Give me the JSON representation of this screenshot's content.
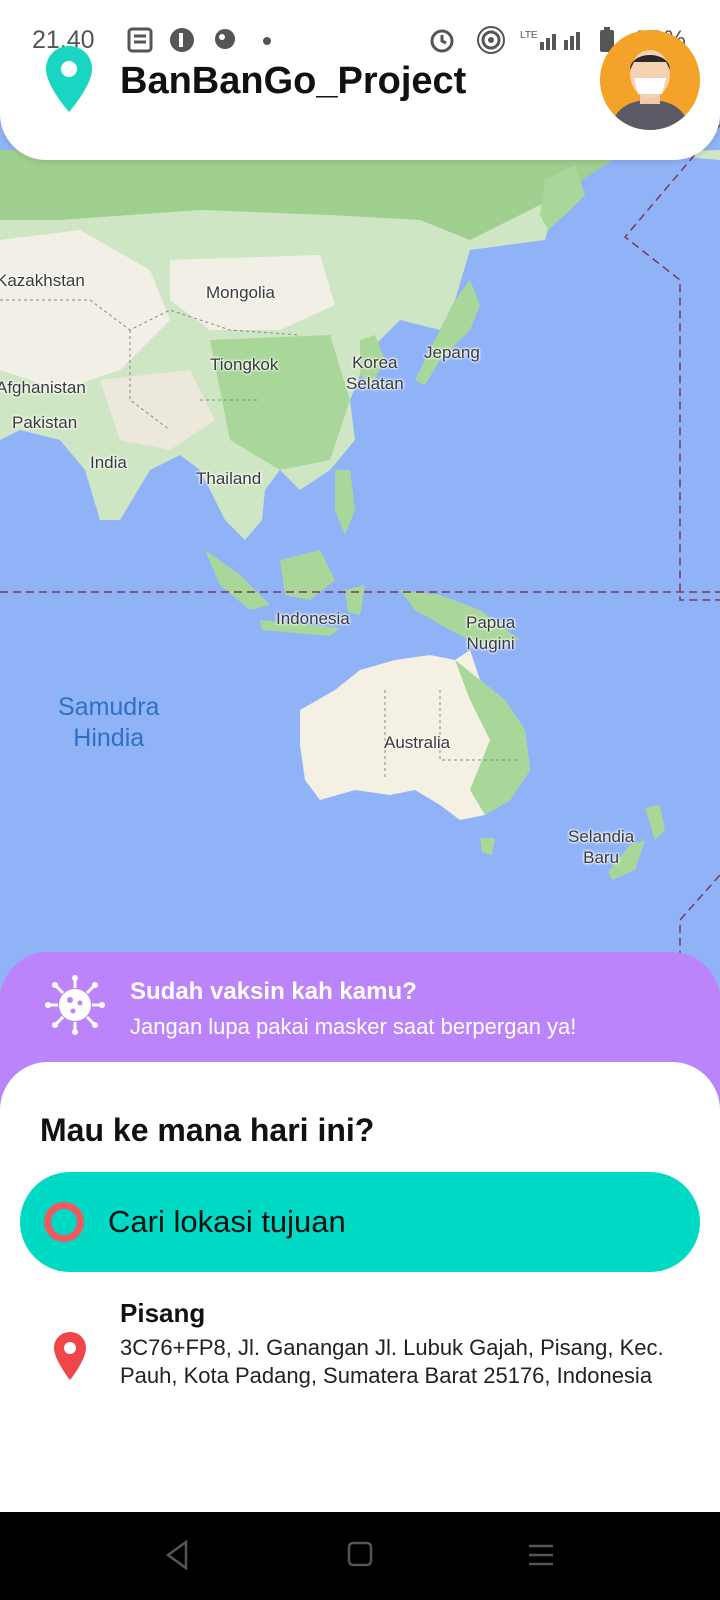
{
  "status_bar": {
    "time": "21.40",
    "network": "LTE",
    "battery": "50%"
  },
  "header": {
    "app_title": "BanBanGo_Project",
    "logo_icon": "location-pin-icon",
    "avatar_icon": "user-avatar-icon"
  },
  "map": {
    "labels": [
      {
        "key": "kazakhstan",
        "text": "Kazakhstan"
      },
      {
        "key": "mongolia",
        "text": "Mongolia"
      },
      {
        "key": "afghanistan",
        "text": "Afghanistan"
      },
      {
        "key": "tiongkok",
        "text": "Tiongkok"
      },
      {
        "key": "korea",
        "text": "Korea\nSelatan"
      },
      {
        "key": "jepang",
        "text": "Jepang"
      },
      {
        "key": "pakistan",
        "text": "Pakistan"
      },
      {
        "key": "india",
        "text": "India"
      },
      {
        "key": "thailand",
        "text": "Thailand"
      },
      {
        "key": "indonesia",
        "text": "Indonesia"
      },
      {
        "key": "papua",
        "text": "Papua\nNugini"
      },
      {
        "key": "australia",
        "text": "Australia"
      },
      {
        "key": "selandia",
        "text": "Selandia\nBaru"
      }
    ],
    "ocean": "Samudra\nHindia"
  },
  "banner": {
    "title": "Sudah vaksin kah kamu?",
    "subtitle": "Jangan lupa pakai masker saat berpergan ya!",
    "icon": "virus-icon",
    "color": "#bc84fa"
  },
  "sheet": {
    "title": "Mau ke mana hari ini?",
    "search_label": "Cari lokasi tujuan",
    "accent": "#00d9c4"
  },
  "recent": {
    "name": "Pisang",
    "address": "3C76+FP8, Jl. Ganangan Jl. Lubuk Gajah, Pisang, Kec. Pauh, Kota Padang, Sumatera Barat 25176, Indonesia"
  }
}
